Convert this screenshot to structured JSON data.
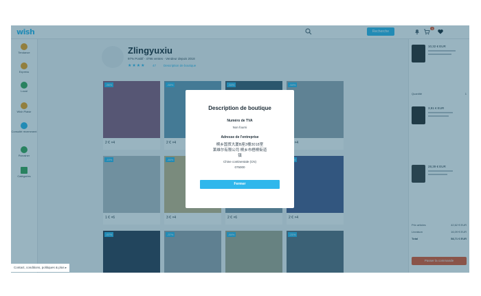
{
  "topbar": {
    "logo": "wish",
    "search_button": "Recherche",
    "cart_count": "1"
  },
  "sidebar": {
    "items": [
      {
        "label": "Tendance",
        "icon": "star-icon",
        "color": "#f2a21b"
      },
      {
        "label": "Express",
        "icon": "truck-icon",
        "color": "#f2a21b"
      },
      {
        "label": "Local",
        "icon": "pin-icon",
        "color": "#3aa757"
      },
      {
        "label": "Wish Plaisir",
        "icon": "gift-icon",
        "color": "#f2a21b"
      },
      {
        "label": "Consulté récemment",
        "icon": "clock-icon",
        "color": "#2fb7ec"
      },
      {
        "label": "Parrainer",
        "icon": "shield-icon",
        "color": "#3aa757"
      },
      {
        "label": "Catégories",
        "icon": "grid-icon",
        "color": "#3aa757"
      }
    ]
  },
  "store": {
    "name": "Zlingyuxiu",
    "stats": "97% Positif · 4796 ventes · Vendeur depuis 2018",
    "stars": "★★★★",
    "review_count": "47",
    "desc_link": "Description de boutique"
  },
  "products": [
    {
      "badge": "-56%",
      "price": "2 € ×4",
      "color": "#8a5a7a"
    },
    {
      "badge": "-58%",
      "price": "2 € ×4",
      "color": "#6a9ab4"
    },
    {
      "badge": "-54%",
      "price": "3 € ×4",
      "color": "#3d5a6e"
    },
    {
      "badge": "-54%",
      "price": "3 € ×4",
      "color": "#9aa8b2"
    },
    {
      "badge": "-15%",
      "price": "1 € ×6",
      "color": "#b8c0c6"
    },
    {
      "badge": "-46%",
      "price": "3 € ×4",
      "color": "#c8b88a"
    },
    {
      "badge": "-15%",
      "price": "2 € ×6",
      "color": "#7e95a4"
    },
    {
      "badge": "-31%",
      "price": "2 € ×4",
      "color": "#4a5a8e"
    },
    {
      "badge": "-67%",
      "price": "",
      "color": "#2e3c52"
    },
    {
      "badge": "-37%",
      "price": "",
      "color": "#9aa4ac"
    },
    {
      "badge": "-84%",
      "price": "",
      "color": "#a8a890"
    },
    {
      "badge": "-21%",
      "price": "",
      "color": "#5a6e7e"
    }
  ],
  "right_panel": {
    "items": [
      {
        "price": "10,32 € EUR",
        "color": "#2b2b2b"
      },
      {
        "price": "3,91 € EUR",
        "color": "#2b2b2b"
      },
      {
        "price": "28,39 € EUR",
        "color": "#3a3a3a"
      }
    ],
    "rows": [
      {
        "label": "Quantité",
        "value": "1"
      },
      {
        "label": "Prix articles",
        "value": "42,62 € EUR"
      },
      {
        "label": "Livraison",
        "value": "16,09 € EUR"
      },
      {
        "label": "Total",
        "value": "58,71 € EUR"
      }
    ],
    "checkout": "Passer la commande"
  },
  "modal": {
    "title": "Description de boutique",
    "vat_heading": "Numéro de TVA",
    "vat_value": "Non fourni",
    "address_heading": "Adresse de l'entreprise",
    "address_lines": [
      "桐乡国贸大厦B座3楼3018室",
      "莱维尔有限公司 桐乡市梧桐街道",
      "镇"
    ],
    "country": "Chine continentale (CN)",
    "postcode": "075000",
    "button": "Fermer"
  },
  "footer": {
    "link": "Contact, conditions, politiques & plus ▸"
  }
}
